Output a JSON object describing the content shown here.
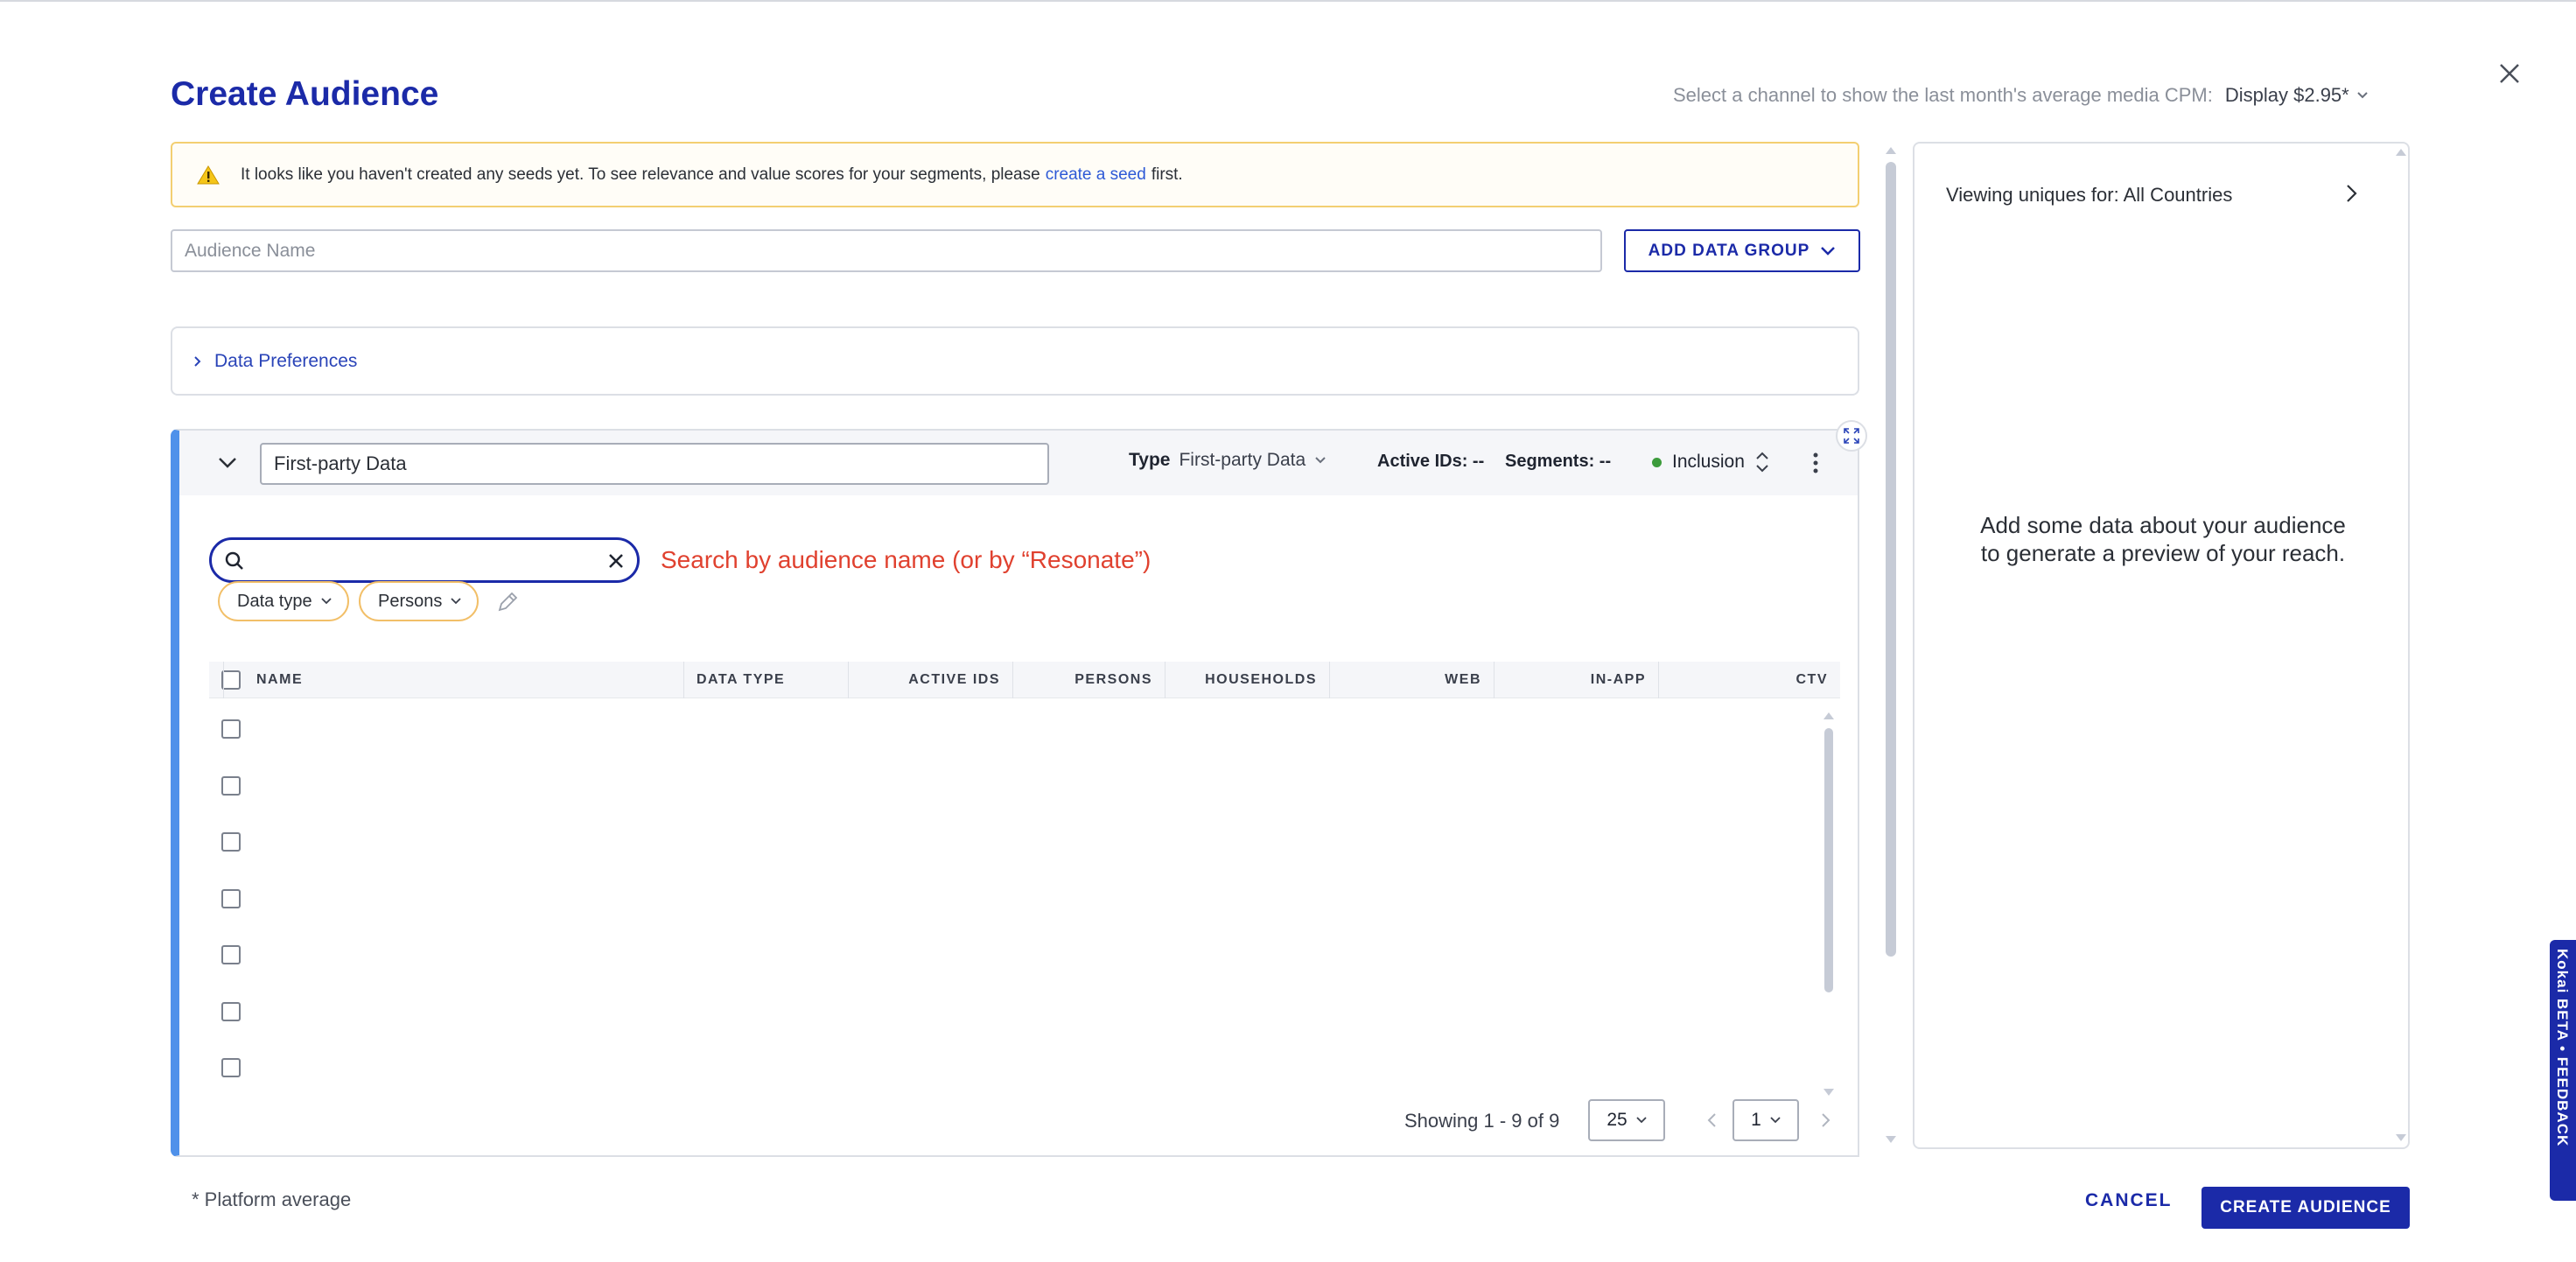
{
  "header": {
    "title": "Create Audience",
    "cpm_label": "Select a channel to show the last month's average media CPM:",
    "cpm_value": "Display $2.95*"
  },
  "warning": {
    "text_before": "It looks like you haven't created any seeds yet. To see relevance and value scores for your segments, please",
    "link": "create a seed",
    "text_after": "first."
  },
  "audience_name": {
    "placeholder": "Audience Name",
    "value": ""
  },
  "add_data_group": "ADD DATA GROUP",
  "data_preferences": "Data Preferences",
  "group": {
    "name": "First-party Data",
    "type_label": "Type",
    "type_value": "First-party Data",
    "active_ids": "Active IDs: --",
    "segments": "Segments: --",
    "inclusion": "Inclusion",
    "search": {
      "value": "",
      "placeholder": ""
    },
    "search_hint": "Search by audience name (or by “Resonate”)",
    "filters": [
      "Data type",
      "Persons"
    ],
    "columns": [
      "NAME",
      "DATA TYPE",
      "ACTIVE IDS",
      "PERSONS",
      "HOUSEHOLDS",
      "WEB",
      "IN-APP",
      "CTV"
    ],
    "row_count": 7,
    "pagination": {
      "showing": "Showing 1 - 9 of 9",
      "page_size": "25",
      "page": "1"
    }
  },
  "preview": {
    "viewing": "Viewing uniques for: All Countries",
    "message_line1": "Add some data about your audience",
    "message_line2": "to generate a preview of your reach."
  },
  "feedback": "Kokai BETA • FEEDBACK",
  "footer": {
    "note": "* Platform average",
    "cancel": "CANCEL",
    "create": "CREATE AUDIENCE"
  },
  "colors": {
    "brand": "#1b2aa8",
    "link": "#2d59d6",
    "warning_border": "#f3cf72",
    "group_accent": "#4f91ea",
    "hint": "#e0412f",
    "chip_border": "#f2bf68",
    "inclusion_dot": "#3c9b3c"
  },
  "icons": [
    "close-icon",
    "warning-icon",
    "chevron-down-icon",
    "chevron-right-icon",
    "search-icon",
    "clear-icon",
    "pencil-icon",
    "kebab-icon",
    "expand-icon",
    "sort-icon"
  ]
}
